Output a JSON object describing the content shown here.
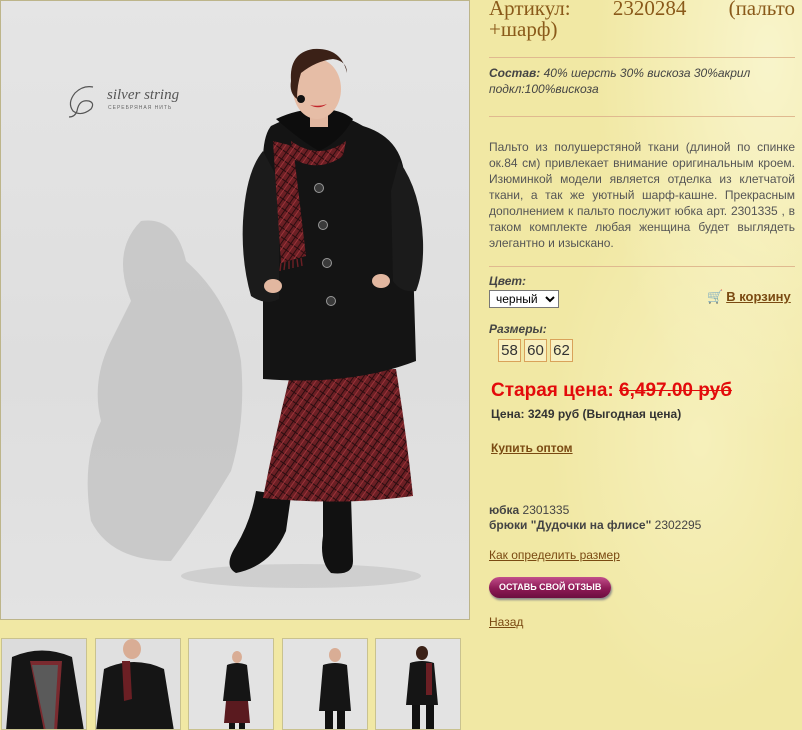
{
  "product": {
    "title_line1_word1": "Артикул:",
    "title_line1_word2": "2320284",
    "title_line1_word3": "(пальто",
    "title_line2": "+шарф)",
    "composition_label": "Состав:",
    "composition_text": "40% шерсть 30% вискоза 30%акрил подкл:100%вискоза",
    "description": "Пальто из полушерстяной ткани (длиной по спинке ок.84 см) привлекает внимание оригинальным кроем. Изюминкой модели является отделка из клетчатой ткани, а так же уютный шарф-кашне. Прекрасным дополнением к пальто послужит юбка арт. 2301335 , в таком комплекте любая женщина будет выглядеть элегантно и изыскано."
  },
  "color": {
    "label": "Цвет:",
    "selected": "черный"
  },
  "cart": {
    "label": "В корзину",
    "icon": "cart-icon"
  },
  "sizes": {
    "label": "Размеры:",
    "items": [
      "58",
      "60",
      "62"
    ]
  },
  "pricing": {
    "old_label": "Старая цена:",
    "old_value": "6,497.00 руб",
    "current": "Цена: 3249 руб (Выгодная цена)"
  },
  "links": {
    "wholesale": "Купить оптом",
    "size_guide": "Как определить размер",
    "back": "Назад"
  },
  "related": [
    {
      "name": "юбка",
      "code": "2301335"
    },
    {
      "name": "брюки \"Дудочки на флисе\"",
      "code": "2302295"
    }
  ],
  "review_button": "ОСТАВЬ СВОЙ ОТЗЫВ",
  "brand": {
    "name": "silver string",
    "subtitle": "СЕРЕБРЯНАЯ НИТЬ"
  },
  "colors": {
    "background": "#f1e8a4",
    "link": "#7a4a12",
    "old_price": "#e30b0b"
  }
}
